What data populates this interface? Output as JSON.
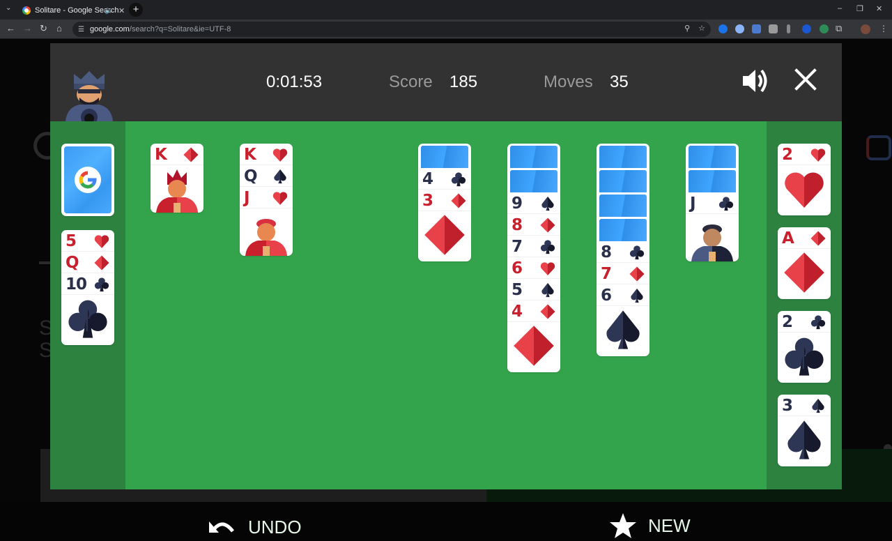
{
  "browser": {
    "tab_title": "Solitare - Google Search",
    "url_host": "google.com",
    "url_path": "/search?q=Solitare&ie=UTF-8",
    "icons": [
      "tab-search-icon",
      "audio-icon",
      "close-tab-icon",
      "new-tab-icon",
      "back-icon",
      "forward-icon",
      "reload-icon",
      "home-icon",
      "site-info-icon",
      "zoom-icon",
      "bookmark-star-icon",
      "extensions-icon",
      "profile-avatar",
      "menu-kebab-icon"
    ]
  },
  "hud": {
    "time": "0:01:53",
    "score_label": "Score",
    "score_value": "185",
    "moves_label": "Moves",
    "moves_value": "35"
  },
  "controls": {
    "undo_label": "UNDO",
    "new_label": "NEW"
  },
  "colors": {
    "felt": "#34a44c",
    "rail": "#2d8240",
    "header": "#323232",
    "red_suit": "#e8414a",
    "black_suit": "#2a2f4a",
    "card_back": "#3fa6ff"
  },
  "stock": {
    "face_down": true,
    "label": "G"
  },
  "waste": [
    {
      "rank": "5",
      "suit": "hearts"
    },
    {
      "rank": "Q",
      "suit": "diamonds"
    },
    {
      "rank": "10",
      "suit": "clubs"
    }
  ],
  "tableau": [
    {
      "hidden": 0,
      "cards": [
        {
          "rank": "K",
          "suit": "diamonds"
        }
      ]
    },
    {
      "hidden": 0,
      "cards": [
        {
          "rank": "K",
          "suit": "hearts"
        },
        {
          "rank": "Q",
          "suit": "spades"
        },
        {
          "rank": "J",
          "suit": "hearts"
        }
      ]
    },
    {
      "hidden": 0,
      "cards": []
    },
    {
      "hidden": 1,
      "cards": [
        {
          "rank": "4",
          "suit": "clubs"
        },
        {
          "rank": "3",
          "suit": "diamonds"
        }
      ]
    },
    {
      "hidden": 2,
      "cards": [
        {
          "rank": "9",
          "suit": "spades"
        },
        {
          "rank": "8",
          "suit": "diamonds"
        },
        {
          "rank": "7",
          "suit": "clubs"
        },
        {
          "rank": "6",
          "suit": "hearts"
        },
        {
          "rank": "5",
          "suit": "spades"
        },
        {
          "rank": "4",
          "suit": "diamonds"
        }
      ]
    },
    {
      "hidden": 4,
      "cards": [
        {
          "rank": "8",
          "suit": "clubs"
        },
        {
          "rank": "7",
          "suit": "diamonds"
        },
        {
          "rank": "6",
          "suit": "spades"
        }
      ]
    },
    {
      "hidden": 2,
      "cards": [
        {
          "rank": "J",
          "suit": "clubs"
        }
      ]
    }
  ],
  "foundations": [
    {
      "rank": "2",
      "suit": "hearts"
    },
    {
      "rank": "A",
      "suit": "diamonds"
    },
    {
      "rank": "2",
      "suit": "clubs"
    },
    {
      "rank": "3",
      "suit": "spades"
    }
  ]
}
